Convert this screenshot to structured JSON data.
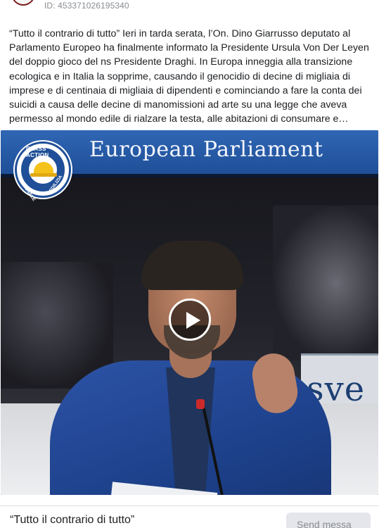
{
  "header": {
    "post_id": "ID: 453371026195340"
  },
  "post": {
    "text": "“Tutto il contrario di tutto” Ieri in tarda serata, l’On. Dino Giarrusso deputato al Parlamento Europeo ha finalmente informato la Presidente Ursula Von Der Leyen del doppio gioco del ns Presidente Draghi. In Europa inneggia alla transizione ecologica e in Italia la sopprime, causando il genocidio di decine di migliaia di imprese e di centinaia di migliaia di dipendenti e cominciando a fare la conta dei suicidi a causa delle decine di manomissioni ad arte su una legge che aveva permesso al mondo edile di rialzare la testa, alle abitazioni di consumare e…"
  },
  "video": {
    "banner_title": "European Parliament",
    "sign_text": "sve",
    "logo": {
      "top": "CLASS ACTION",
      "left": "NAZIONALE",
      "right": "EDILIZIA"
    }
  },
  "footer": {
    "caption": "“Tutto il contrario di tutto”",
    "send_label": "Send messa"
  }
}
